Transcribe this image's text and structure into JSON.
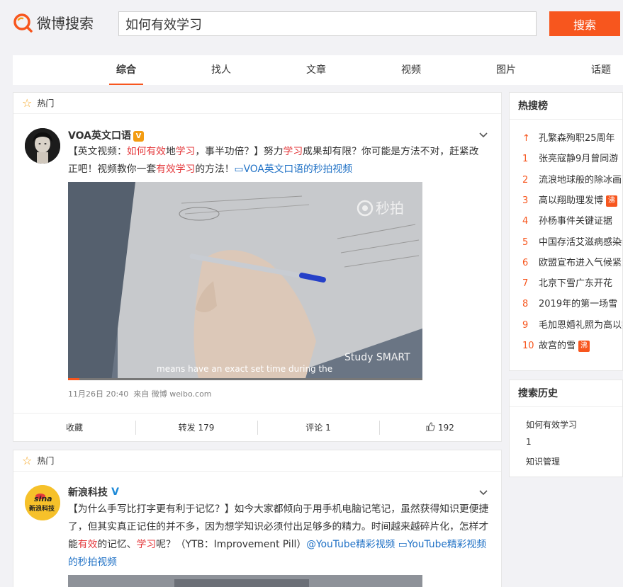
{
  "header": {
    "logo_text": "微博搜索",
    "search_value": "如何有效学习",
    "search_button": "搜索",
    "brand_color": "#f7561e"
  },
  "tabs": [
    {
      "label": "综合",
      "active": true
    },
    {
      "label": "找人",
      "active": false
    },
    {
      "label": "文章",
      "active": false
    },
    {
      "label": "视频",
      "active": false
    },
    {
      "label": "图片",
      "active": false
    },
    {
      "label": "话题",
      "active": false
    }
  ],
  "posts": [
    {
      "section_label": "热门",
      "username": "VOA英文口语",
      "verify_badge": "V",
      "text_parts": [
        {
          "t": "【英文视频：",
          "c": ""
        },
        {
          "t": "如何有效",
          "c": "hl"
        },
        {
          "t": "地",
          "c": ""
        },
        {
          "t": "学习",
          "c": "hl"
        },
        {
          "t": "，事半功倍？】努力",
          "c": ""
        },
        {
          "t": "学习",
          "c": "hl"
        },
        {
          "t": "成果却有限？你可能是方法不对，赶紧改正吧！视频教你一套",
          "c": ""
        },
        {
          "t": "有效学习",
          "c": "hl"
        },
        {
          "t": "的方法！",
          "c": ""
        },
        {
          "t": "▭VOA英文口语的秒拍视频",
          "c": "lk"
        }
      ],
      "video_watermark": "秒拍",
      "video_brand": "Study SMART",
      "video_subtitle": "means have an exact set time during the",
      "timestamp": "11月26日 20:40",
      "source": "来自 微博 weibo.com",
      "actions": {
        "favorite": "收藏",
        "repost": "转发 179",
        "comment": "评论 1",
        "like_count": "192"
      }
    },
    {
      "section_label": "热门",
      "username": "新浪科技",
      "verify_badge": "V",
      "avatar_text": "sina 新浪科技",
      "text_parts": [
        {
          "t": "【为什么手写比打字更有利于记忆？】如今大家都倾向于用手机电脑记笔记，虽然获得知识更便捷了，但其实真正记住的并不多，因为想学知识必须付出足够多的精力。时间越来越碎片化，怎样才能",
          "c": ""
        },
        {
          "t": "有效",
          "c": "hl"
        },
        {
          "t": "的记忆、",
          "c": ""
        },
        {
          "t": "学习",
          "c": "hl"
        },
        {
          "t": "呢？（YTB：Improvement Pill）",
          "c": ""
        },
        {
          "t": "@YouTube精彩视频",
          "c": "lk"
        },
        {
          "t": " ",
          "c": ""
        },
        {
          "t": "▭YouTube精彩视频的秒拍视频",
          "c": "lk"
        }
      ]
    }
  ],
  "hot_search": {
    "title": "热搜榜",
    "items": [
      {
        "rank": "↑",
        "text": "孔繁森殉职25周年",
        "badge": ""
      },
      {
        "rank": "1",
        "text": "张亮寇静9月曾同游",
        "badge": ""
      },
      {
        "rank": "2",
        "text": "流浪地球般的除冰画面",
        "badge": ""
      },
      {
        "rank": "3",
        "text": "高以翔助理发博",
        "badge": "沸"
      },
      {
        "rank": "4",
        "text": "孙杨事件关键证据",
        "badge": ""
      },
      {
        "rank": "5",
        "text": "中国存活艾滋病感染者",
        "badge": ""
      },
      {
        "rank": "6",
        "text": "欧盟宣布进入气候紧急",
        "badge": ""
      },
      {
        "rank": "7",
        "text": "北京下雪广东开花",
        "badge": ""
      },
      {
        "rank": "8",
        "text": "2019年的第一场雪",
        "badge": ""
      },
      {
        "rank": "9",
        "text": "毛加恩婚礼照为高以翔",
        "badge": ""
      },
      {
        "rank": "10",
        "text": "故宫的雪",
        "badge": "沸"
      }
    ]
  },
  "search_history": {
    "title": "搜索历史",
    "items": [
      "如何有效学习",
      "1",
      "知识管理"
    ]
  }
}
